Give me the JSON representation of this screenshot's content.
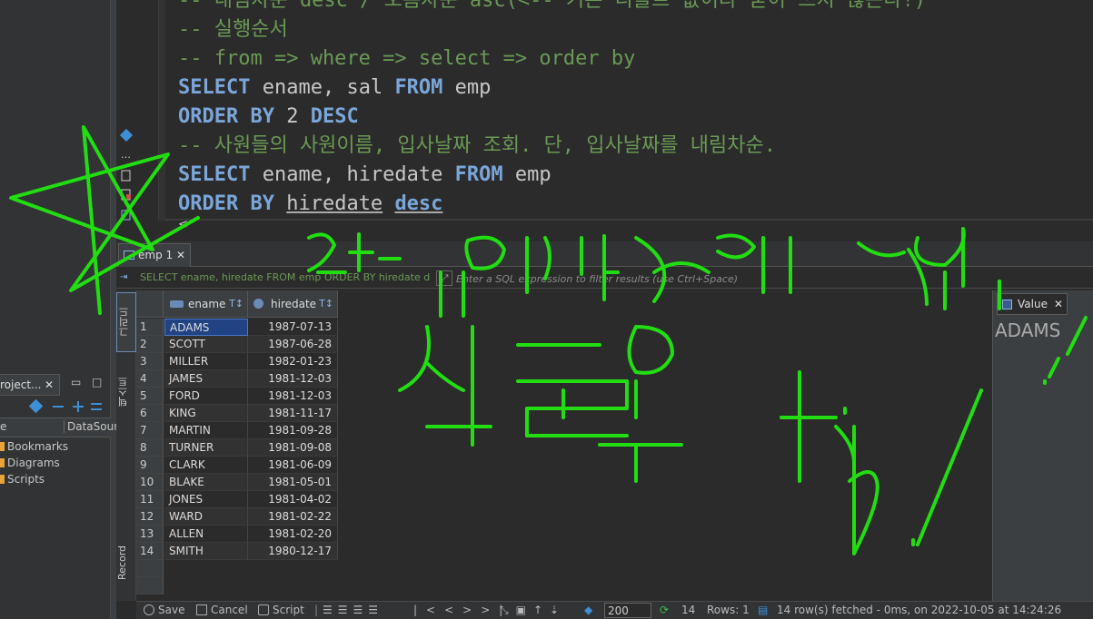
{
  "project_panel": {
    "tab_label": "roject...",
    "col_name": "e",
    "col_datasource": "DataSour",
    "items": [
      "Bookmarks",
      "Diagrams",
      "Scripts"
    ]
  },
  "editor": {
    "lines": [
      {
        "parts": [
          {
            "t": "-- 내림차순 desc / 오름차순 asc(<-- 기본 디폴트 값이라 굳이 쓰지 않는다!)",
            "c": "comment"
          }
        ]
      },
      {
        "parts": [
          {
            "t": "-- 실행순서",
            "c": "comment"
          }
        ]
      },
      {
        "parts": [
          {
            "t": "-- from => where => select => order by",
            "c": "comment"
          }
        ]
      },
      {
        "parts": [
          {
            "t": "SELECT",
            "c": "kw"
          },
          {
            "t": " ename, sal ",
            "c": "ident"
          },
          {
            "t": "FROM",
            "c": "kw"
          },
          {
            "t": " emp",
            "c": "ident"
          }
        ]
      },
      {
        "parts": [
          {
            "t": "ORDER BY",
            "c": "kw"
          },
          {
            "t": " 2 ",
            "c": "ident"
          },
          {
            "t": "DESC",
            "c": "kw"
          }
        ]
      },
      {
        "parts": [
          {
            "t": "-- 사원들의 사원이름, 입사날짜 조회. 단, 입사날짜를 내림차순.",
            "c": "comment"
          }
        ]
      },
      {
        "parts": [
          {
            "t": "SELECT",
            "c": "kw"
          },
          {
            "t": " ename, hiredate ",
            "c": "ident"
          },
          {
            "t": "FROM",
            "c": "kw"
          },
          {
            "t": " emp",
            "c": "ident"
          }
        ]
      },
      {
        "parts": [
          {
            "t": "ORDER BY",
            "c": "kw"
          },
          {
            "t": " ",
            "c": "ident"
          },
          {
            "t": "hiredate",
            "c": "ident underline"
          },
          {
            "t": " ",
            "c": "ident"
          },
          {
            "t": "desc",
            "c": "kw underline"
          }
        ]
      }
    ]
  },
  "results": {
    "tab_label": "emp 1",
    "filter_query": "SELECT ename, hiredate FROM emp ORDER BY hiredate de:",
    "filter_placeholder": "Enter a SQL expression to filter results (use Ctrl+Space)",
    "side_tabs": {
      "grid": "그리드",
      "text": "텍스트",
      "record": "Record"
    },
    "columns": {
      "ename": "ename",
      "hiredate": "hiredate"
    },
    "rows": [
      {
        "n": "1",
        "ename": "ADAMS",
        "hiredate": "1987-07-13"
      },
      {
        "n": "2",
        "ename": "SCOTT",
        "hiredate": "1987-06-28"
      },
      {
        "n": "3",
        "ename": "MILLER",
        "hiredate": "1982-01-23"
      },
      {
        "n": "4",
        "ename": "JAMES",
        "hiredate": "1981-12-03"
      },
      {
        "n": "5",
        "ename": "FORD",
        "hiredate": "1981-12-03"
      },
      {
        "n": "6",
        "ename": "KING",
        "hiredate": "1981-11-17"
      },
      {
        "n": "7",
        "ename": "MARTIN",
        "hiredate": "1981-09-28"
      },
      {
        "n": "8",
        "ename": "TURNER",
        "hiredate": "1981-09-08"
      },
      {
        "n": "9",
        "ename": "CLARK",
        "hiredate": "1981-06-09"
      },
      {
        "n": "10",
        "ename": "BLAKE",
        "hiredate": "1981-05-01"
      },
      {
        "n": "11",
        "ename": "JONES",
        "hiredate": "1981-04-02"
      },
      {
        "n": "12",
        "ename": "WARD",
        "hiredate": "1981-02-22"
      },
      {
        "n": "13",
        "ename": "ALLEN",
        "hiredate": "1981-02-20"
      },
      {
        "n": "14",
        "ename": "SMITH",
        "hiredate": "1980-12-17"
      }
    ],
    "value_panel": {
      "tab_label": "Value",
      "value": "ADAMS"
    }
  },
  "status_bar": {
    "save": "Save",
    "cancel": "Cancel",
    "script": "Script",
    "limit": "200",
    "count": "14",
    "rows": "Rows: 1",
    "fetched": "14 row(s) fetched - 0ms, on 2022-10-05 at 14:24:26"
  },
  "annotation": {
    "color": "#22dd11",
    "lines": [
      "2가 아니라! 제대로 명시!!",
      "실무용 tip!"
    ]
  }
}
